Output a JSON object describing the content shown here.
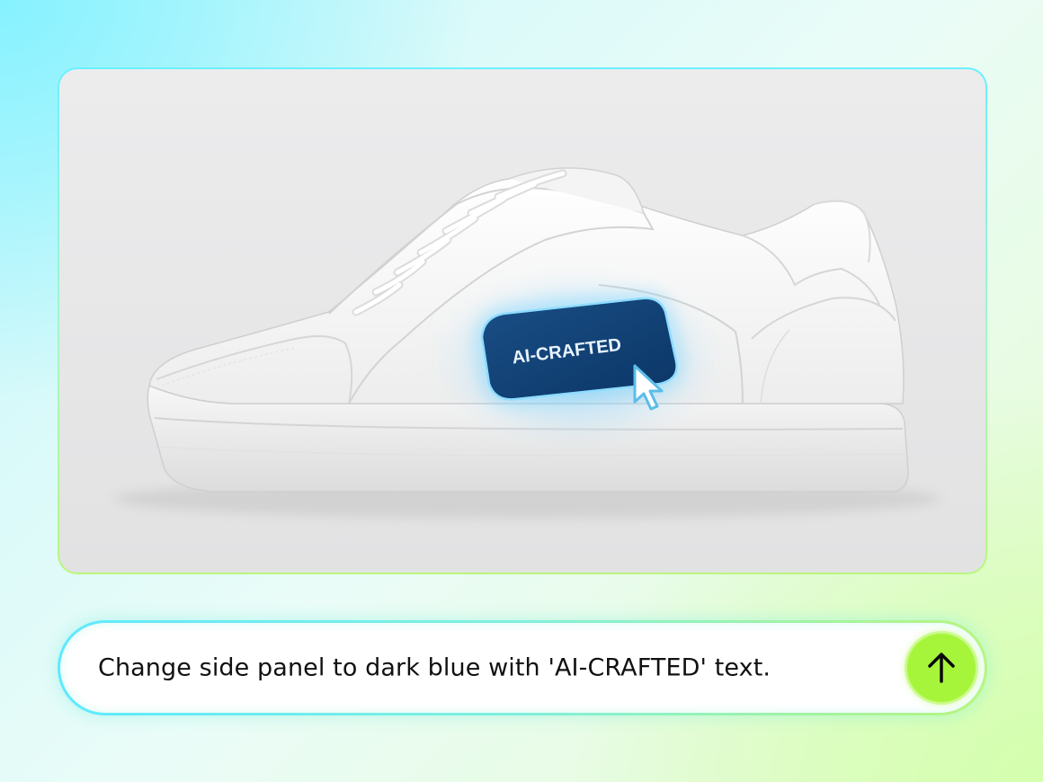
{
  "preview": {
    "panel_label": "AI-CRAFTED",
    "icons": [
      "sneaker-image",
      "pointer-cursor-icon"
    ]
  },
  "prompt": {
    "text": "Change side panel to dark blue with 'AI-CRAFTED' text.",
    "send_icon": "arrow-up-icon"
  },
  "colors": {
    "accent_green": "#a6f53b",
    "border_cyan": "#5ee9ff",
    "panel_dark_blue": "#0e3f75",
    "panel_glow": "#38b6ff"
  }
}
